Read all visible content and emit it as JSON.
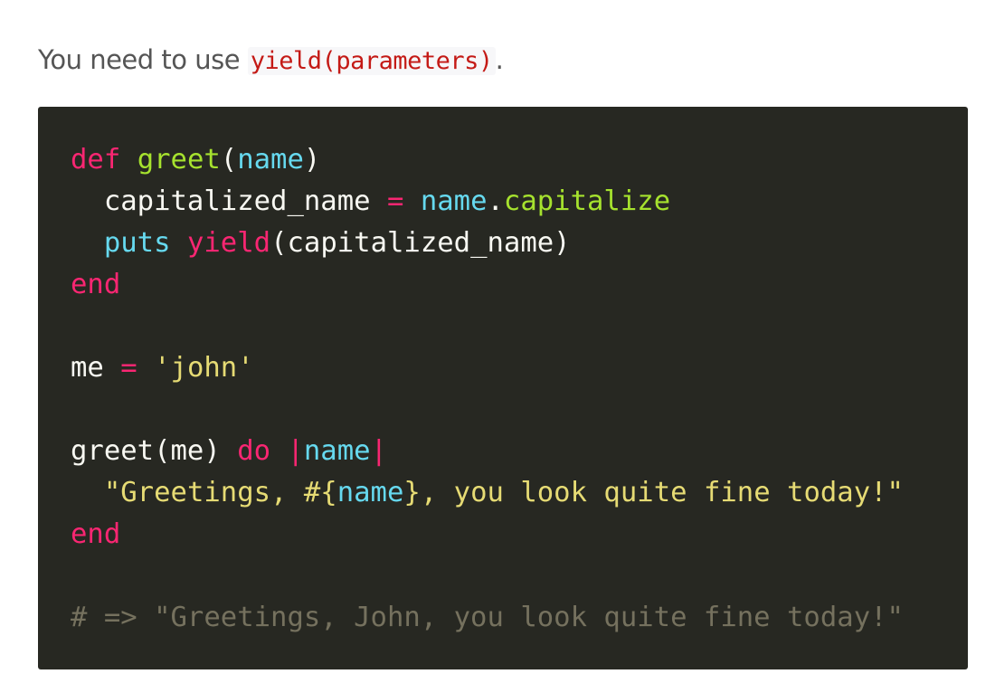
{
  "intro": {
    "before": "You need to use ",
    "code": "yield(parameters)",
    "after": "."
  },
  "code_block": {
    "language": "ruby",
    "theme_colors": {
      "background": "#272822",
      "keyword": "#f92672",
      "function": "#a6e22e",
      "variable": "#66d9ef",
      "string": "#e6db74",
      "comment": "#75715e",
      "text": "#f8f8f2"
    },
    "lines": [
      [
        {
          "t": "def",
          "c": "kw"
        },
        {
          "t": " ",
          "c": "txt"
        },
        {
          "t": "greet",
          "c": "fn"
        },
        {
          "t": "(",
          "c": "txt"
        },
        {
          "t": "name",
          "c": "var"
        },
        {
          "t": ")",
          "c": "txt"
        }
      ],
      [
        {
          "t": "  capitalized_name ",
          "c": "txt"
        },
        {
          "t": "=",
          "c": "op"
        },
        {
          "t": " ",
          "c": "txt"
        },
        {
          "t": "name",
          "c": "var"
        },
        {
          "t": ".",
          "c": "txt"
        },
        {
          "t": "capitalize",
          "c": "fn"
        }
      ],
      [
        {
          "t": "  ",
          "c": "txt"
        },
        {
          "t": "puts",
          "c": "var"
        },
        {
          "t": " ",
          "c": "txt"
        },
        {
          "t": "yield",
          "c": "kw"
        },
        {
          "t": "(capitalized_name)",
          "c": "txt"
        }
      ],
      [
        {
          "t": "end",
          "c": "kw"
        }
      ],
      [],
      [
        {
          "t": "me ",
          "c": "txt"
        },
        {
          "t": "=",
          "c": "op"
        },
        {
          "t": " ",
          "c": "txt"
        },
        {
          "t": "'john'",
          "c": "str"
        }
      ],
      [],
      [
        {
          "t": "greet(me) ",
          "c": "txt"
        },
        {
          "t": "do",
          "c": "kw"
        },
        {
          "t": " ",
          "c": "txt"
        },
        {
          "t": "|",
          "c": "op"
        },
        {
          "t": "name",
          "c": "var"
        },
        {
          "t": "|",
          "c": "op"
        }
      ],
      [
        {
          "t": "  ",
          "c": "txt"
        },
        {
          "t": "\"Greetings, ",
          "c": "str"
        },
        {
          "t": "#{",
          "c": "str"
        },
        {
          "t": "name",
          "c": "var"
        },
        {
          "t": "}",
          "c": "str"
        },
        {
          "t": ", you look quite fine today!\"",
          "c": "str"
        }
      ],
      [
        {
          "t": "end",
          "c": "kw"
        }
      ],
      [],
      [
        {
          "t": "# => \"Greetings, John, you look quite fine today!\"",
          "c": "cmt"
        }
      ]
    ]
  }
}
